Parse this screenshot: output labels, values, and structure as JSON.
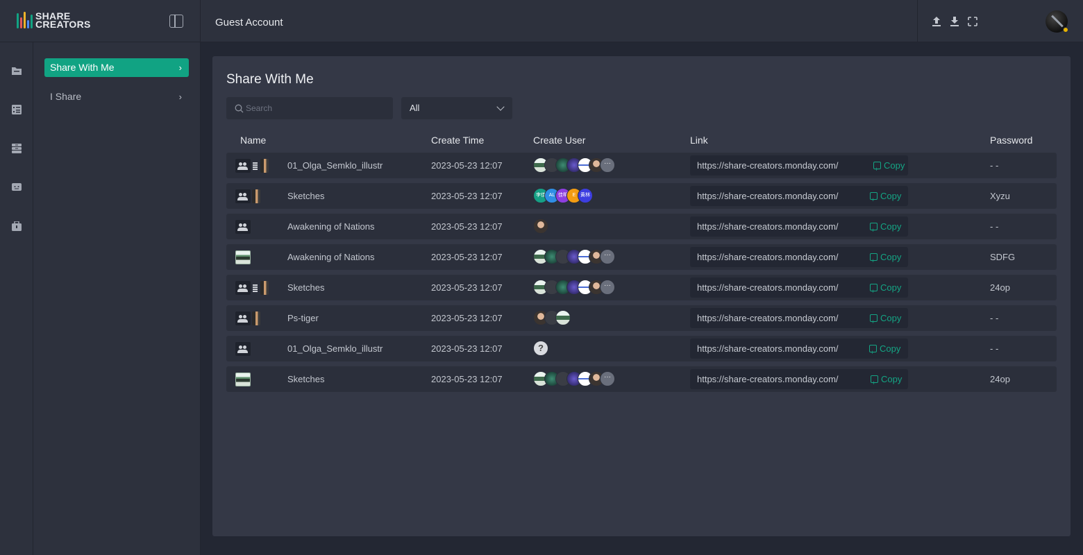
{
  "header": {
    "logo": {
      "line1": "SHARE",
      "line2": "CREATORS",
      "bar_colors": [
        "#11a383",
        "#e25a5a",
        "#f0b429",
        "#4c8cf5",
        "#11a383"
      ]
    },
    "title": "Guest Account",
    "tools": [
      "upload-icon",
      "download-icon",
      "fullscreen-icon"
    ]
  },
  "rail": {
    "icons": [
      "folder-icon",
      "checklist-icon",
      "storage-icon",
      "chat-icon",
      "briefcase-icon"
    ]
  },
  "subnav": {
    "items": [
      {
        "label": "Share With Me",
        "active": true
      },
      {
        "label": "I Share",
        "active": false
      }
    ]
  },
  "main": {
    "title": "Share With Me",
    "search_placeholder": "Search",
    "filter_value": "All",
    "columns": {
      "name": "Name",
      "create_time": "Create Time",
      "create_user": "Create User",
      "link": "Link",
      "password": "Password"
    },
    "copy_label": "Copy",
    "rows": [
      {
        "name": "01_Olga_Semklo_illustr",
        "time": "2023-05-23 12:07",
        "link": "https://share-creators.monday.com/",
        "password": "- -"
      },
      {
        "name": "Sketches",
        "time": "2023-05-23 12:07",
        "link": "https://share-creators.monday.com/",
        "password": "Xyzu"
      },
      {
        "name": "Awakening of Nations",
        "time": "2023-05-23 12:07",
        "link": "https://share-creators.monday.com/",
        "password": "- -"
      },
      {
        "name": "Awakening of Nations",
        "time": "2023-05-23 12:07",
        "link": "https://share-creators.monday.com/",
        "password": "SDFG"
      },
      {
        "name": "Sketches",
        "time": "2023-05-23 12:07",
        "link": "https://share-creators.monday.com/",
        "password": "24op"
      },
      {
        "name": "Ps-tiger",
        "time": "2023-05-23 12:07",
        "link": "https://share-creators.monday.com/",
        "password": "- -"
      },
      {
        "name": "01_Olga_Semklo_illustr",
        "time": "2023-05-23 12:07",
        "link": "https://share-creators.monday.com/",
        "password": "- -"
      },
      {
        "name": "Sketches",
        "time": "2023-05-23 12:07",
        "link": "https://share-creators.monday.com/",
        "password": "24op"
      }
    ],
    "row2_user_labels": [
      "李佳",
      "AL",
      "佳明",
      "E",
      "黄林"
    ],
    "more_label": "···",
    "unknown_user_label": "?"
  },
  "colors": {
    "accent": "#11a383",
    "background": "#232733",
    "panel": "#2d313d",
    "card": "#343846"
  }
}
